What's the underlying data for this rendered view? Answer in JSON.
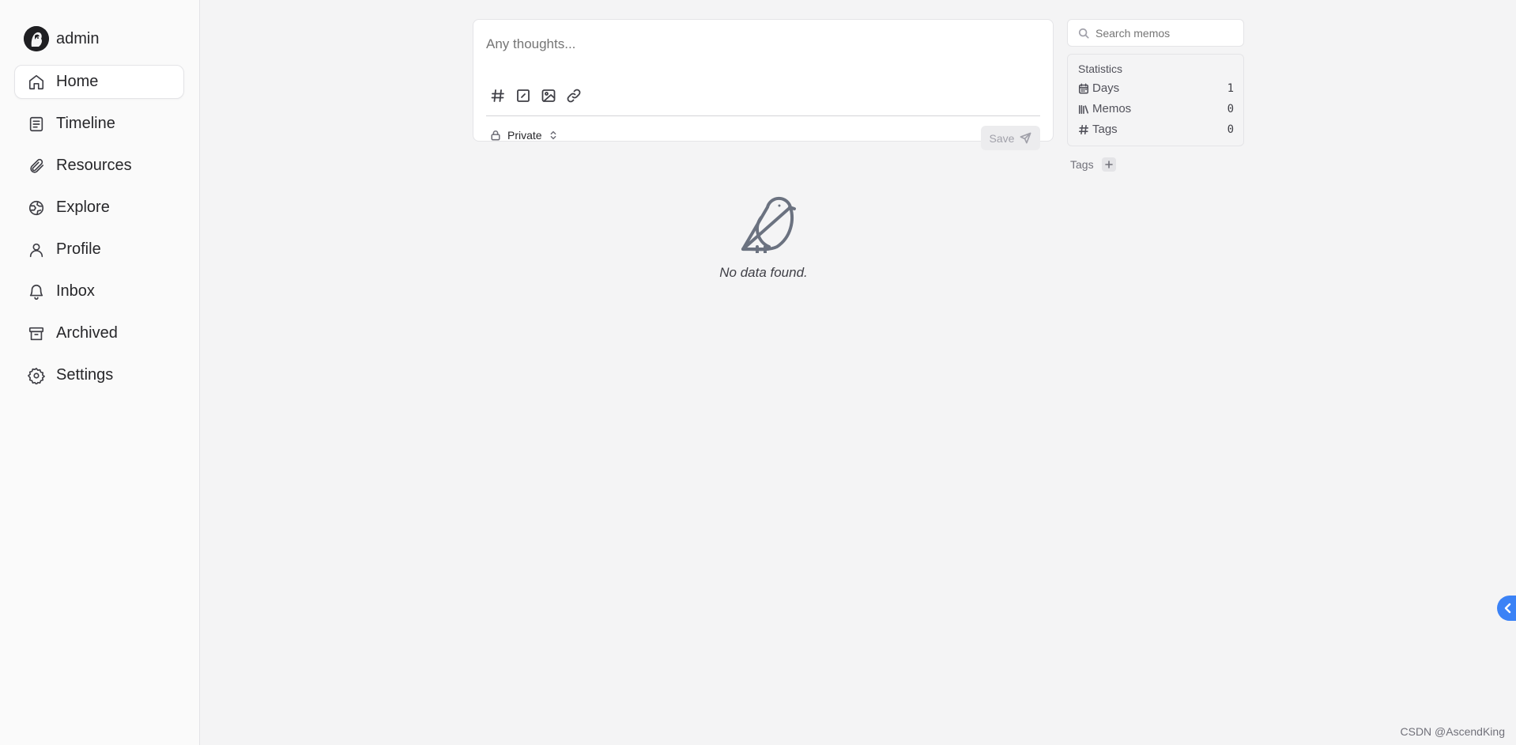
{
  "user": {
    "name": "admin"
  },
  "sidebar": {
    "items": [
      {
        "label": "Home",
        "icon": "home-icon",
        "active": true
      },
      {
        "label": "Timeline",
        "icon": "timeline-icon"
      },
      {
        "label": "Resources",
        "icon": "paperclip-icon"
      },
      {
        "label": "Explore",
        "icon": "globe-icon"
      },
      {
        "label": "Profile",
        "icon": "user-icon"
      },
      {
        "label": "Inbox",
        "icon": "bell-icon"
      },
      {
        "label": "Archived",
        "icon": "archive-icon"
      },
      {
        "label": "Settings",
        "icon": "gear-icon"
      }
    ]
  },
  "editor": {
    "placeholder": "Any thoughts...",
    "tools": [
      "hashtag-icon",
      "checkbox-icon",
      "image-icon",
      "link-icon"
    ],
    "visibility": "Private",
    "save_label": "Save"
  },
  "empty_state": {
    "text": "No data found."
  },
  "search": {
    "placeholder": "Search memos"
  },
  "statistics": {
    "title": "Statistics",
    "rows": [
      {
        "label": "Days",
        "value": "1",
        "icon": "calendar-icon"
      },
      {
        "label": "Memos",
        "value": "0",
        "icon": "library-icon"
      },
      {
        "label": "Tags",
        "value": "0",
        "icon": "hashtag-icon"
      }
    ]
  },
  "tags": {
    "label": "Tags"
  },
  "watermark": "CSDN @AscendKing",
  "colors": {
    "accent": "#3b82f6",
    "background": "#f4f4f5",
    "sidebar": "#fafafa"
  }
}
